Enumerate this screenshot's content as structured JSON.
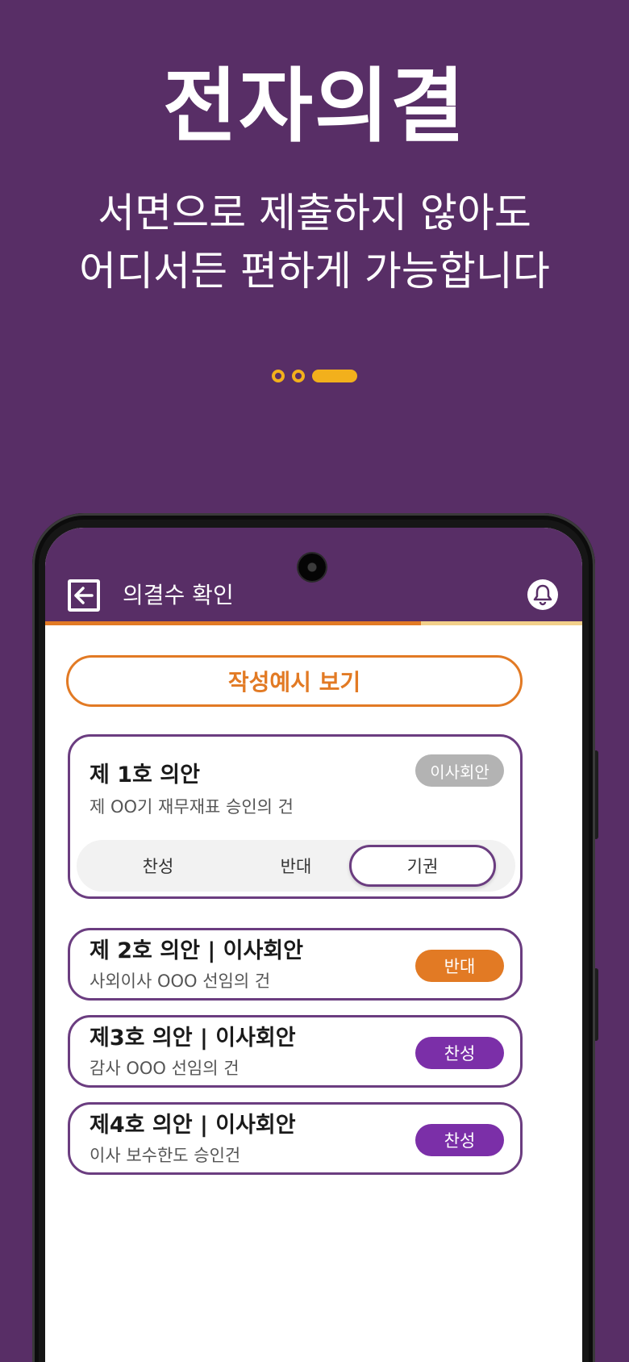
{
  "hero": {
    "title": "전자의결",
    "subtitle_line1": "서면으로 제출하지 않아도",
    "subtitle_line2": "어디서든 편하게 가능합니다"
  },
  "pager": {
    "total": 3,
    "active": 3
  },
  "app": {
    "header_title": "의결수 확인",
    "progress_fraction": 0.7,
    "example_button": "작성예시 보기",
    "expanded_item": {
      "title": "제 1호 의안",
      "description": "제 OO기 재무재표 승인의 건",
      "tag": "이사회안",
      "options": [
        "찬성",
        "반대",
        "기권"
      ],
      "selected": "기권"
    },
    "items": [
      {
        "title": "제 2호 의안 | 이사회안",
        "description": "사외이사 OOO 선임의 건",
        "status": "반대"
      },
      {
        "title": "제3호 의안 | 이사회안",
        "description": "감사 OOO 선임의 건",
        "status": "찬성"
      },
      {
        "title": "제4호 의안 | 이사회안",
        "description": "이사 보수한도 승인건",
        "status": "찬성"
      }
    ]
  },
  "colors": {
    "background": "#582e66",
    "accent_orange": "#e27a24",
    "accent_purple": "#7b2fa8",
    "pager_yellow": "#f2b01c",
    "tag_gray": "#b3b3b3"
  }
}
